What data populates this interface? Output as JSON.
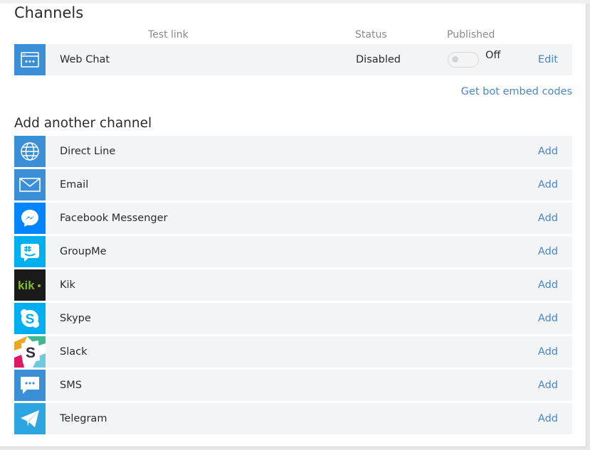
{
  "channels": {
    "title": "Channels",
    "columns": {
      "test_link": "Test link",
      "status": "Status",
      "published": "Published"
    },
    "active": [
      {
        "name": "Web Chat",
        "icon": "webchat-icon",
        "status": "Disabled",
        "published": "Off",
        "action": "Edit"
      }
    ],
    "embed_link": "Get bot embed codes"
  },
  "add_section": {
    "title": "Add another channel",
    "items": [
      {
        "name": "Direct Line",
        "icon": "globe-icon",
        "action": "Add",
        "color": "#3a8fd6"
      },
      {
        "name": "Email",
        "icon": "envelope-icon",
        "action": "Add",
        "color": "#3a8fd6"
      },
      {
        "name": "Facebook Messenger",
        "icon": "messenger-icon",
        "action": "Add",
        "color": "#0084ff"
      },
      {
        "name": "GroupMe",
        "icon": "groupme-icon",
        "action": "Add",
        "color": "#00aff0"
      },
      {
        "name": "Kik",
        "icon": "kik-icon",
        "action": "Add",
        "color": "#1a1a1a"
      },
      {
        "name": "Skype",
        "icon": "skype-icon",
        "action": "Add",
        "color": "#00aff0"
      },
      {
        "name": "Slack",
        "icon": "slack-icon",
        "action": "Add",
        "color": "#ffffff"
      },
      {
        "name": "SMS",
        "icon": "sms-icon",
        "action": "Add",
        "color": "#3a8fd6"
      },
      {
        "name": "Telegram",
        "icon": "telegram-icon",
        "action": "Add",
        "color": "#2ca5e0"
      }
    ]
  },
  "colors": {
    "link": "#4a86c6",
    "row_bg": "#f3f4f6"
  }
}
